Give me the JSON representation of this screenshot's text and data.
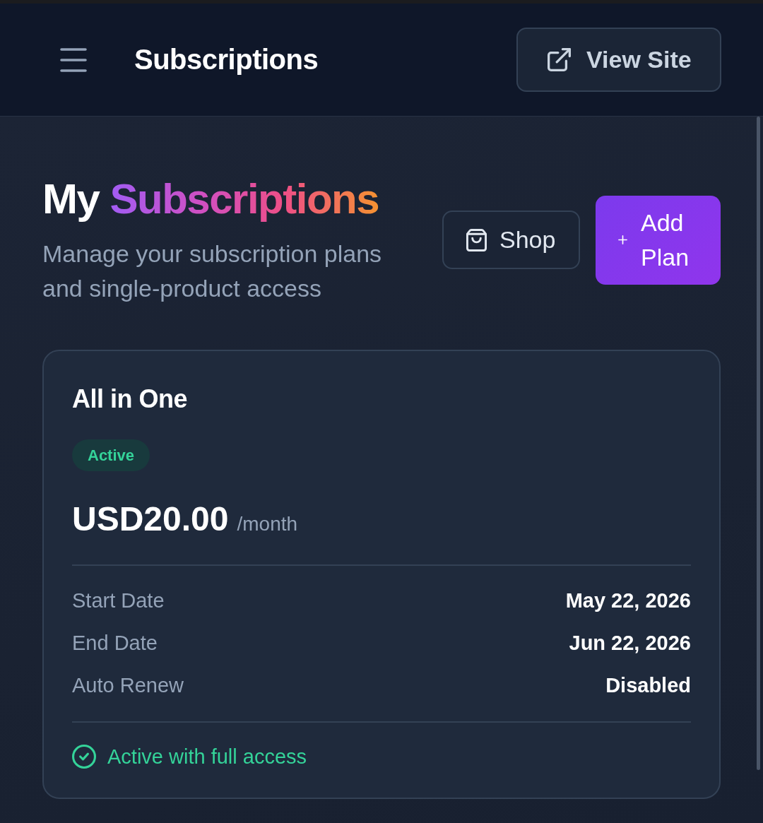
{
  "topbar": {
    "title": "Subscriptions",
    "view_site_button": "View Site"
  },
  "header": {
    "title": "My",
    "title_highlight": "Subscriptions",
    "subtitle": "Manage your subscription plans and single-product access",
    "buttons": [
      {
        "label": "Shop",
        "kind": "outline"
      },
      {
        "label": "Add Plan",
        "kind": "primary"
      }
    ]
  },
  "subscriptions": [
    {
      "name": "All in One",
      "status": "Active",
      "price": "USD20.00",
      "period": "/month",
      "details": [
        {
          "label": "Start Date",
          "value": "May 22, 2026"
        },
        {
          "label": "End Date",
          "value": "Jun 22, 2026"
        },
        {
          "label": "Auto Renew",
          "value": "Disabled"
        }
      ],
      "access_note": "Active with full access"
    }
  ]
}
